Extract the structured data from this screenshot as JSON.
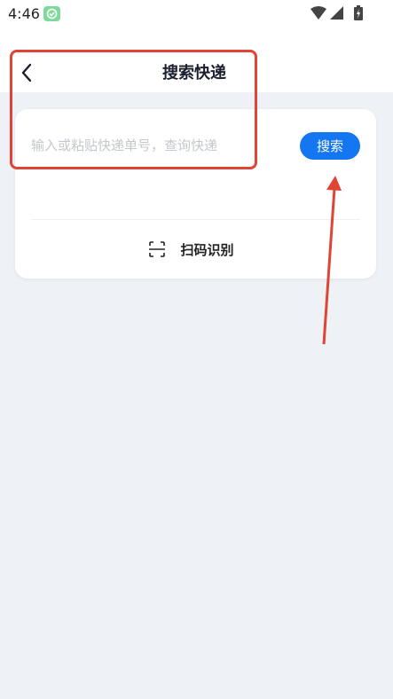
{
  "status_bar": {
    "time": "4:46",
    "icons": [
      "app-notification-icon",
      "wifi-icon",
      "signal-icon",
      "battery-icon"
    ]
  },
  "header": {
    "title": "搜索快递",
    "back_icon": "chevron-left-icon"
  },
  "search": {
    "placeholder": "输入或粘贴快递单号，查询快递",
    "value": "",
    "button_label": "搜索"
  },
  "scan": {
    "label": "扫码识别",
    "icon": "scan-icon"
  },
  "colors": {
    "accent": "#1476f0",
    "background": "#eef2f7",
    "annotation": "#e04434"
  }
}
